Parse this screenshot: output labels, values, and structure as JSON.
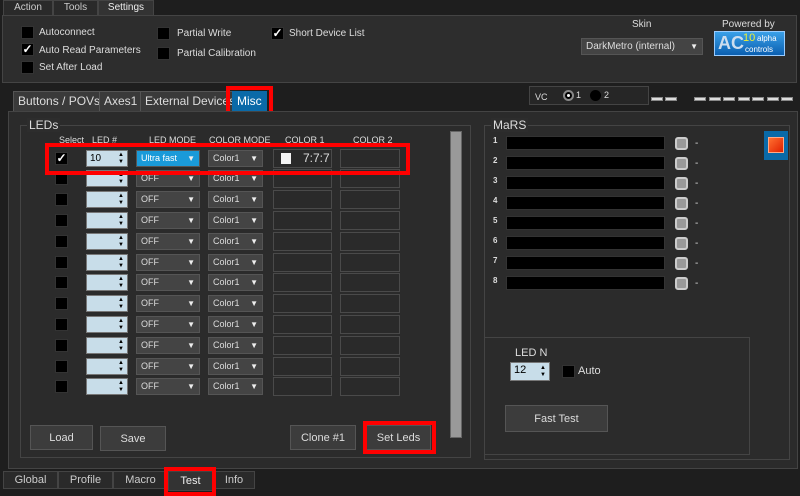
{
  "top_tabs": [
    "Action",
    "Tools",
    "Settings"
  ],
  "settings": {
    "autoconnect": {
      "label": "Autoconnect",
      "checked": false
    },
    "auto_read": {
      "label": "Auto Read Parameters",
      "checked": true
    },
    "set_after_load": {
      "label": "Set After Load",
      "checked": false
    },
    "partial_write": {
      "label": "Partial Write",
      "checked": false
    },
    "partial_calibration": {
      "label": "Partial Calibration",
      "checked": false
    },
    "short_device_list": {
      "label": "Short Device List",
      "checked": true
    },
    "skin_label": "Skin",
    "skin_value": "DarkMetro (internal)",
    "powered_by": "Powered by",
    "logo_text": "10 alpha controls"
  },
  "inner_tabs": [
    "Buttons / POVs",
    "Axes1",
    "External Devices",
    "Misc"
  ],
  "vc": {
    "label": "VC",
    "opt1": "1",
    "opt2": "2",
    "selected": "1"
  },
  "leds": {
    "title": "LEDs",
    "headers": [
      "Select",
      "LED #",
      "LED MODE",
      "COLOR MODE",
      "COLOR 1",
      "COLOR 2"
    ],
    "rows": [
      {
        "selected": true,
        "num": "10",
        "mode": "Ultra fast",
        "color_mode": "Color1",
        "color1": "7:7:7",
        "color1_swatch": "#f4f4f4",
        "color2": ""
      },
      {
        "selected": false,
        "num": "",
        "mode": "OFF",
        "color_mode": "Color1",
        "color1": "",
        "color2": ""
      },
      {
        "selected": false,
        "num": "",
        "mode": "OFF",
        "color_mode": "Color1",
        "color1": "",
        "color2": ""
      },
      {
        "selected": false,
        "num": "",
        "mode": "OFF",
        "color_mode": "Color1",
        "color1": "",
        "color2": ""
      },
      {
        "selected": false,
        "num": "",
        "mode": "OFF",
        "color_mode": "Color1",
        "color1": "",
        "color2": ""
      },
      {
        "selected": false,
        "num": "",
        "mode": "OFF",
        "color_mode": "Color1",
        "color1": "",
        "color2": ""
      },
      {
        "selected": false,
        "num": "",
        "mode": "OFF",
        "color_mode": "Color1",
        "color1": "",
        "color2": ""
      },
      {
        "selected": false,
        "num": "",
        "mode": "OFF",
        "color_mode": "Color1",
        "color1": "",
        "color2": ""
      },
      {
        "selected": false,
        "num": "",
        "mode": "OFF",
        "color_mode": "Color1",
        "color1": "",
        "color2": ""
      },
      {
        "selected": false,
        "num": "",
        "mode": "OFF",
        "color_mode": "Color1",
        "color1": "",
        "color2": ""
      },
      {
        "selected": false,
        "num": "",
        "mode": "OFF",
        "color_mode": "Color1",
        "color1": "",
        "color2": ""
      },
      {
        "selected": false,
        "num": "",
        "mode": "OFF",
        "color_mode": "Color1",
        "color1": "",
        "color2": ""
      }
    ],
    "load": "Load",
    "save": "Save",
    "clone": "Clone #1",
    "set_leds": "Set Leds"
  },
  "mars": {
    "title": "MaRS",
    "rows": [
      {
        "n": "1",
        "v": "-"
      },
      {
        "n": "2",
        "v": "-"
      },
      {
        "n": "3",
        "v": "-"
      },
      {
        "n": "4",
        "v": "-"
      },
      {
        "n": "5",
        "v": "-"
      },
      {
        "n": "6",
        "v": "-"
      },
      {
        "n": "7",
        "v": "-"
      },
      {
        "n": "8",
        "v": "-"
      }
    ],
    "indicator_color": "#ff4010"
  },
  "ledn": {
    "label": "LED N",
    "value": "12",
    "auto": "Auto",
    "auto_checked": false,
    "fast_test": "Fast Test"
  },
  "bottom_tabs": [
    "Global",
    "Profile",
    "Macro",
    "Test",
    "Info"
  ],
  "colors": {
    "accent": "#0a6aa8",
    "highlight": "#ff0000"
  }
}
